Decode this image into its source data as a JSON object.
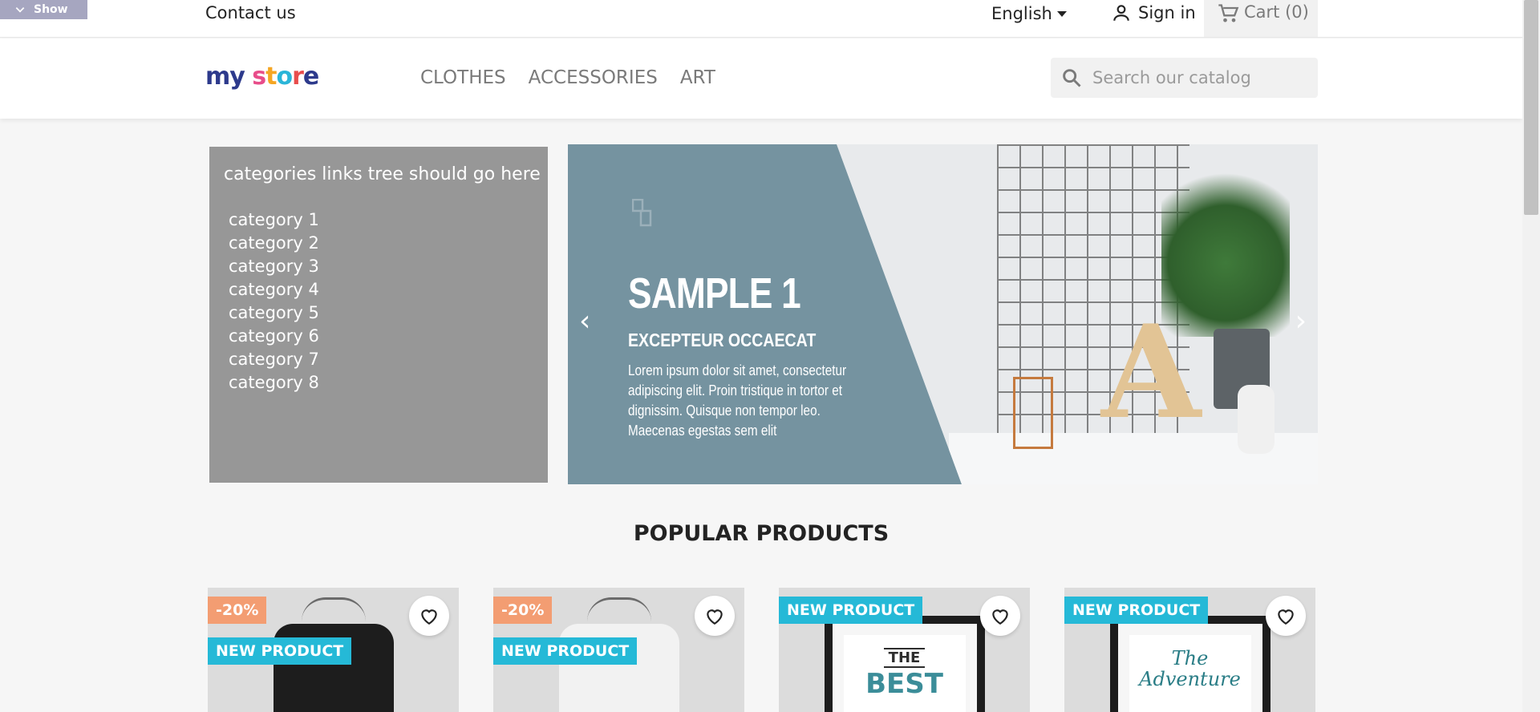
{
  "top_bar": {
    "show_label": "Show",
    "contact_label": "Contact us",
    "language": "English",
    "signin_label": "Sign in",
    "cart_label": "Cart (0)"
  },
  "header": {
    "logo": [
      "my",
      " ",
      "s",
      "t",
      "o",
      "r",
      "e"
    ],
    "nav": [
      "CLOTHES",
      "ACCESSORIES",
      "ART"
    ],
    "search_placeholder": "Search our catalog"
  },
  "categories": {
    "title": "categories links tree should go here",
    "items": [
      "category 1",
      "category 2",
      "category 3",
      "category 4",
      "category 5",
      "category 6",
      "category 7",
      "category 8"
    ]
  },
  "slider": {
    "title": "SAMPLE 1",
    "subtitle": "EXCEPTEUR OCCAECAT",
    "text": "Lorem ipsum dolor sit amet, consectetur adipiscing elit. Proin tristique in tortor et dignissim. Quisque non tempor leo. Maecenas egestas sem elit",
    "photo_letter": "A",
    "prev": "‹",
    "next": "›"
  },
  "section_title": "POPULAR PRODUCTS",
  "products": [
    {
      "discount": "-20%",
      "new": "NEW PRODUCT",
      "kind": "tshirt-black"
    },
    {
      "discount": "-20%",
      "new": "NEW PRODUCT",
      "kind": "tshirt-white"
    },
    {
      "new": "NEW PRODUCT",
      "kind": "frame-best",
      "art_top": "THE",
      "art_bottom": "BEST"
    },
    {
      "new": "NEW PRODUCT",
      "kind": "frame-adventure",
      "art_top": "The",
      "art_bottom": "Adventure"
    }
  ],
  "colors": {
    "accent": "#25b9d7",
    "discount": "#f39d72",
    "slide_bg": "#7593a0",
    "category_bg": "#979797"
  }
}
